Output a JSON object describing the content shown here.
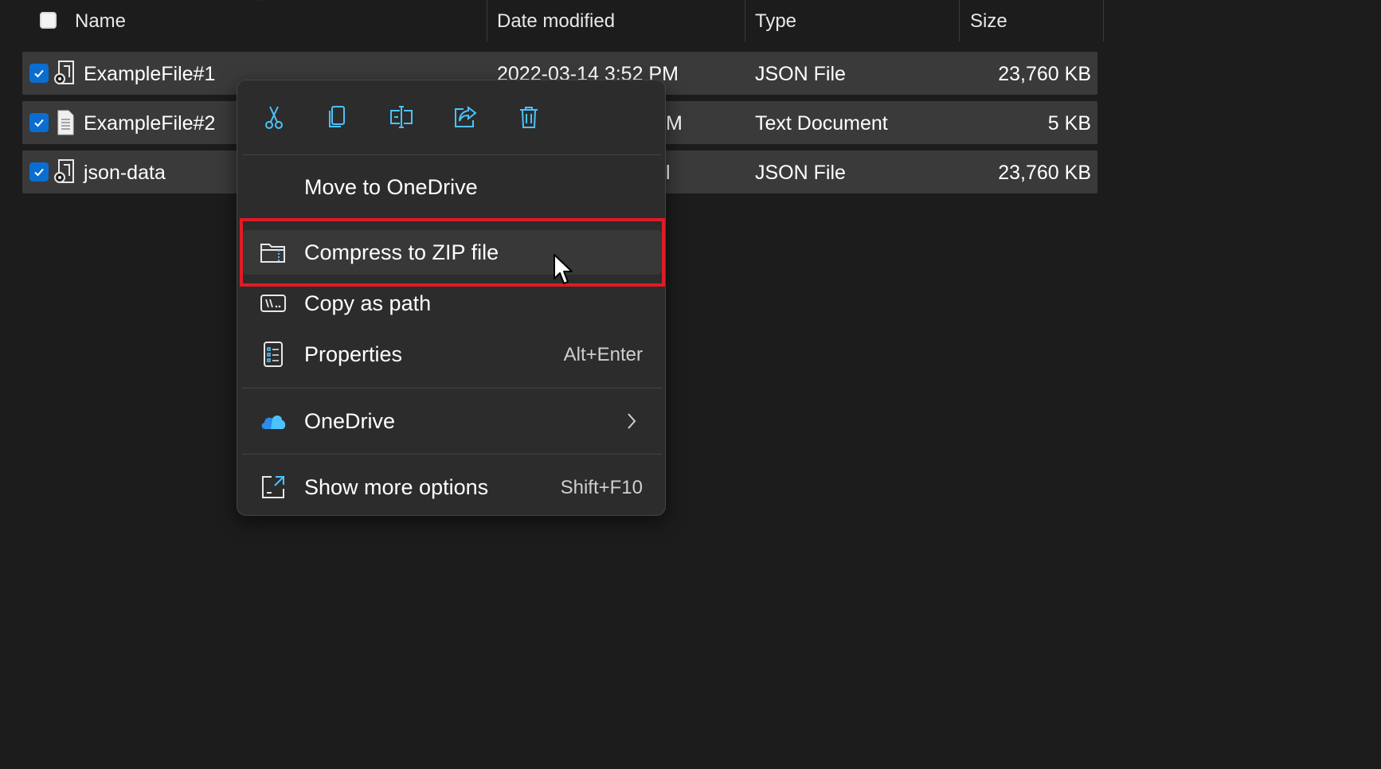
{
  "columns": {
    "name": "Name",
    "date_modified": "Date modified",
    "type": "Type",
    "size": "Size"
  },
  "files": [
    {
      "name": "ExampleFile#1",
      "date": "2022-03-14 3:52 PM",
      "type": "JSON File",
      "size": "23,760 KB",
      "icon": "json-file-icon",
      "checked": true
    },
    {
      "name": "ExampleFile#2",
      "date": "M",
      "type": "Text Document",
      "size": "5 KB",
      "icon": "text-document-icon",
      "checked": true
    },
    {
      "name": "json-data",
      "date": "l",
      "type": "JSON File",
      "size": "23,760 KB",
      "icon": "json-file-icon",
      "checked": true
    }
  ],
  "context_menu": {
    "quick_actions": [
      {
        "name": "cut",
        "icon": "scissors-icon"
      },
      {
        "name": "copy",
        "icon": "copy-icon"
      },
      {
        "name": "rename",
        "icon": "rename-icon"
      },
      {
        "name": "share",
        "icon": "share-icon"
      },
      {
        "name": "delete",
        "icon": "trash-icon"
      }
    ],
    "items": {
      "move_onedrive": {
        "label": "Move to OneDrive"
      },
      "compress_zip": {
        "label": "Compress to ZIP file",
        "icon": "zip-folder-icon"
      },
      "copy_path": {
        "label": "Copy as path",
        "icon": "path-icon"
      },
      "properties": {
        "label": "Properties",
        "shortcut": "Alt+Enter",
        "icon": "properties-icon"
      },
      "onedrive": {
        "label": "OneDrive",
        "icon": "onedrive-cloud-icon"
      },
      "show_more": {
        "label": "Show more options",
        "shortcut": "Shift+F10",
        "icon": "show-more-icon"
      }
    }
  },
  "colors": {
    "background": "#1c1c1c",
    "selected_row": "#3a3a3a",
    "menu_bg": "#2c2c2c",
    "checkbox_accent": "#0a6ed1",
    "highlight_border": "#e01b24",
    "icon_accent": "#4cc2ff"
  }
}
